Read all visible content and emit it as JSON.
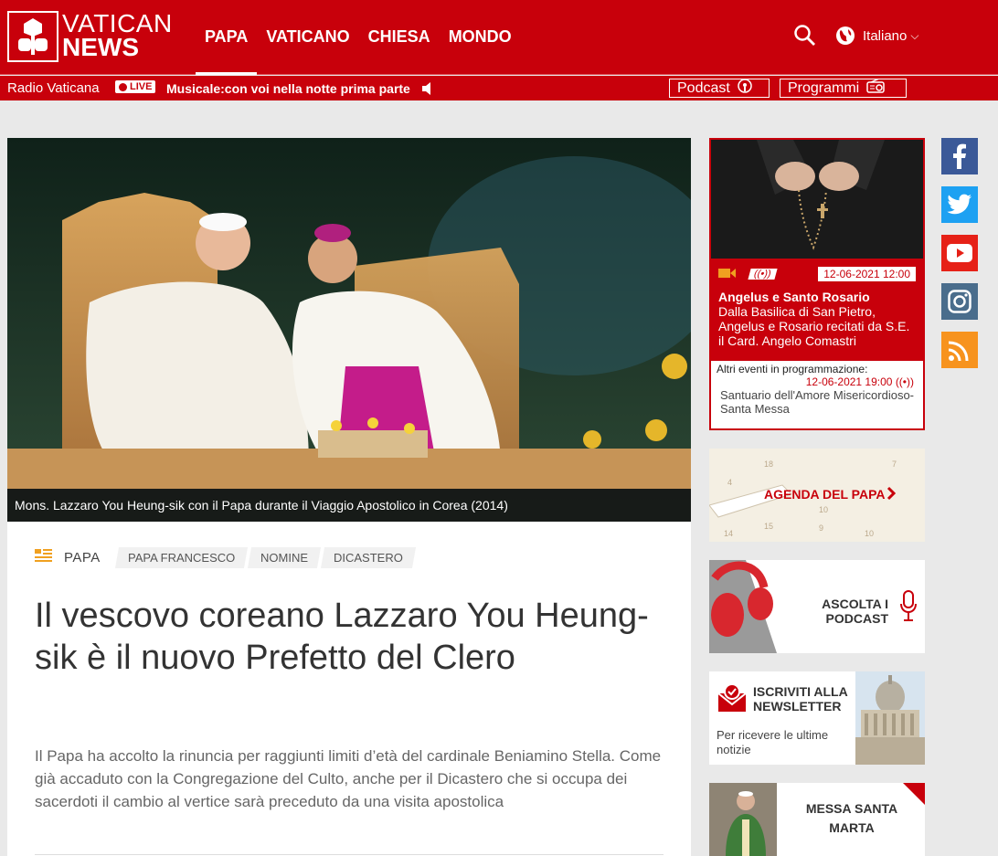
{
  "header": {
    "logo_line1": "VATICAN",
    "logo_line2": "NEWS",
    "nav": [
      "PAPA",
      "VATICANO",
      "CHIESA",
      "MONDO"
    ],
    "language": "Italiano"
  },
  "radio": {
    "name": "Radio Vaticana",
    "live_label": "LIVE",
    "now_playing": "Musicale:con voi nella notte prima parte",
    "podcast_label": "Podcast",
    "programmi_label": "Programmi"
  },
  "article": {
    "caption": "Mons. Lazzaro You Heung-sik con il Papa durante il Viaggio Apostolico in Corea (2014)",
    "section": "PAPA",
    "tags": [
      "PAPA FRANCESCO",
      "NOMINE",
      "DICASTERO"
    ],
    "headline": "Il vescovo coreano Lazzaro You Heung-sik è il nuovo Prefetto del Clero",
    "lead": "Il Papa ha accolto la rinuncia per raggiunti limiti d’età del cardinale Beniamino Stella. Come già accaduto con la Congregazione del Culto, anche per il Dicastero che si occupa dei sacerdoti il cambio al vertice sarà preceduto da una visita apostolica"
  },
  "schedule": {
    "datetime": "12-06-2021 12:00",
    "title": "Angelus e Santo Rosario",
    "description": "Dalla Basilica di San Pietro, Angelus e Rosario recitati da S.E. il Card. Angelo Comastri",
    "other_label": "Altri eventi in programmazione:",
    "other_datetime": "12-06-2021 19:00",
    "other_title": "Santuario dell'Amore Misericordioso-Santa Messa"
  },
  "promos": {
    "agenda": "AGENDA DEL PAPA",
    "podcast_line1": "ASCOLTA I",
    "podcast_line2": "PODCAST",
    "newsletter_line1": "ISCRIVITI ALLA",
    "newsletter_line2": "NEWSLETTER",
    "newsletter_sub": "Per ricevere le ultime notizie",
    "messa_line1": "MESSA SANTA",
    "messa_line2": "MARTA"
  },
  "social": [
    {
      "icon": "facebook-icon",
      "color": "#3b5998",
      "glyph": "f"
    },
    {
      "icon": "twitter-icon",
      "color": "#1da1f2",
      "glyph": ""
    },
    {
      "icon": "youtube-icon",
      "color": "#e62117",
      "glyph": ""
    },
    {
      "icon": "instagram-icon",
      "color": "#4a6d8c",
      "glyph": ""
    },
    {
      "icon": "rss-icon",
      "color": "#f7931e",
      "glyph": ""
    }
  ],
  "colors": {
    "brand_red": "#c8000b",
    "background": "#e9e9e9"
  }
}
